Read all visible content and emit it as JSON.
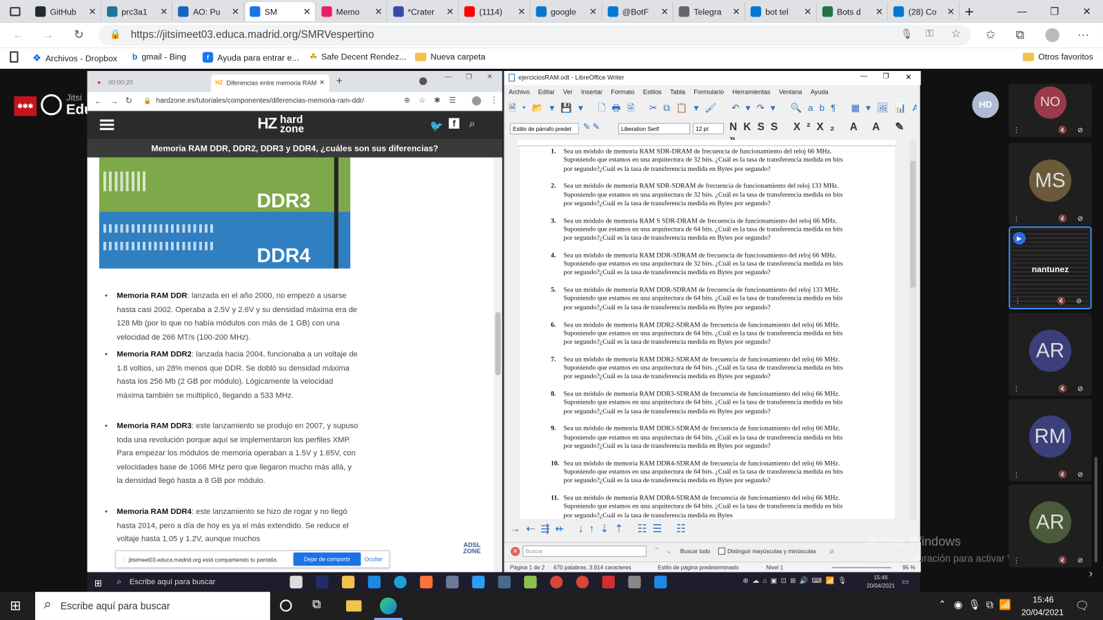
{
  "edge": {
    "tabs": [
      {
        "label": "GitHub",
        "icon": "github-icon",
        "color": "#24292e"
      },
      {
        "label": "prc3a1",
        "icon": "wordpress-icon",
        "color": "#21759b"
      },
      {
        "label": "AO: Pu",
        "icon": "education-icon",
        "color": "#1565c0"
      },
      {
        "label": "SM",
        "icon": "meeting-icon",
        "color": "#1a73e8"
      },
      {
        "label": "Memo",
        "icon": "site-icon",
        "color": "#e91e63"
      },
      {
        "label": "*Crater",
        "icon": "globe-icon",
        "color": "#3949ab"
      },
      {
        "label": "(1114)",
        "icon": "youtube-icon",
        "color": "#ff0000"
      },
      {
        "label": "google",
        "icon": "bing-icon",
        "color": "#0078d4"
      },
      {
        "label": "@BotF",
        "icon": "bing-icon",
        "color": "#0078d4"
      },
      {
        "label": "Telegra",
        "icon": "page-icon",
        "color": "#666666"
      },
      {
        "label": "bot tel",
        "icon": "bing-icon",
        "color": "#0078d4"
      },
      {
        "label": "Bots d",
        "icon": "excel-icon",
        "color": "#217346"
      },
      {
        "label": "(28) Co",
        "icon": "mail-icon",
        "color": "#0078d4"
      }
    ],
    "url": "https://jitsimeet03.educa.madrid.org/SMRVespertino",
    "favorites": [
      "Archivos - Dropbox",
      "gmail - Bing",
      "Ayuda para entrar e...",
      "Safe Decent Rendez...",
      "Nueva carpeta"
    ],
    "other_favorites": "Otros favoritos"
  },
  "jitsi": {
    "brand_small": "Jitsi",
    "brand": "EducaMadrid"
  },
  "left_browser": {
    "tabs": [
      "00:00:20",
      "Diferencias entre memoria RAM"
    ],
    "url": "hardzone.es/tutoriales/componentes/diferencias-memoria-ram-ddr/",
    "logo": "hard zone",
    "headline": "Memoria RAM DDR, DDR2, DDR3 y DDR4, ¿cuáles son sus diferencias?",
    "image_labels": [
      "DDR3",
      "DDR4"
    ],
    "bullets": [
      {
        "title": "Memoria RAM DDR",
        "text": ": lanzada en el año 2000, no empezó a usarse hasta casi 2002. Operaba a 2.5V y 2.6V y su densidad máxima era de 128 Mb (por lo que no había módulos con más de 1 GB) con una velocidad de 266 MT/s (100-200 MHz)."
      },
      {
        "title": "Memoria RAM DDR2",
        "text": ": lanzada hacia 2004, funcionaba a un voltaje de 1.8 voltios, un 28% menos que DDR. Se dobló su densidad máxima hasta los 256 Mb (2 GB por módulo). Lógicamente la velocidad máxima también se multiplicó, llegando a 533 MHz."
      },
      {
        "title": "Memoria RAM DDR3",
        "text": ": este lanzamiento se produjo en 2007, y supuso toda una revolución porque aquí se implementaron los perfiles XMP. Para empezar los módulos de memoria operaban a 1.5V y 1.65V, con velocidades base de 1066 MHz pero que llegaron mucho más allá, y la densidad llegó hasta a 8 GB por módulo."
      },
      {
        "title": "Memoria RAM DDR4",
        "text": ": este lanzamiento se hizo de rogar y no llegó hasta 2014, pero a día de hoy es ya el más extendido. Se reduce el voltaje hasta 1.05 y 1.2V, aunque muchos"
      }
    ],
    "share_text": "jitsimeet03.educa.madrid.org está compartiendo tu pantalla.",
    "share_stop": "Dejar de compartir",
    "share_hide": "Ocultar",
    "adsl_zone": "ADSL ZONE"
  },
  "writer": {
    "title": "ejerciciosRAM.odt - LibreOffice Writer",
    "menu": [
      "Archivo",
      "Editar",
      "Ver",
      "Insertar",
      "Formato",
      "Estilos",
      "Tabla",
      "Formulario",
      "Herramientas",
      "Ventana",
      "Ayuda"
    ],
    "para_style": "Estilo de párrafo predet",
    "font": "Liberation Serif",
    "size": "12 pt",
    "questions": [
      "Sea un módulo de memoria RAM SDR-DRAM de frecuencia de funcionamiento del reloj 66 MHz. Suponiendo que estamos en una arquitectura de 32 bits. ¿Cuál es la tasa de transferencia medida en bits por segundo?¿Cuál es la tasa de transferencia medida en Bytes por segundo?",
      "Sea un módulo de memoria RAM SDR-SDRAM de frecuencia de funcionamiento del reloj 133 MHz. Suponiendo que estamos en una arquitectura de 32 bits. ¿Cuál es la tasa de transferencia medida en bits por segundo?¿Cuál es la tasa de transferencia medida en Bytes por segundo?",
      "Sea un módulo de memoria RAM S SDR-DRAM de frecuencia de funcionamiento del reloj 66 MHz. Suponiendo que estamos en una arquitectura de 64 bits. ¿Cuál es la tasa de transferencia medida en bits por segundo?¿Cuál es la tasa de transferencia medida en Bytes por segundo?",
      "Sea un módulo de memoria RAM DDR-SDRAM de frecuencia de funcionamiento del reloj 66 MHz. Suponiendo que estamos en una arquitectura de 32 bits. ¿Cuál es la tasa de transferencia medida en bits por segundo?¿Cuál es la tasa de transferencia medida en Bytes por segundo?",
      "Sea un módulo de memoria RAM DDR-SDRAM de frecuencia de funcionamiento del reloj 133 MHz. Suponiendo que estamos en una arquitectura de 64 bits. ¿Cuál es la tasa de transferencia medida en bits por segundo?¿Cuál es la tasa de transferencia medida en Bytes por segundo?",
      "Sea un módulo de memoria RAM DDR2-SDRAM de frecuencia de funcionamiento del reloj 66 MHz. Suponiendo que estamos en una arquitectura de 64 bits. ¿Cuál es la tasa de transferencia medida en bits por segundo?¿Cuál es la tasa de transferencia medida en Bytes por segundo?",
      "Sea un módulo de memoria RAM DDR2-SDRAM de frecuencia de funcionamiento del reloj 66 MHz. Suponiendo que estamos en una arquitectura de 64 bits. ¿Cuál es la tasa de transferencia medida en bits por segundo?¿Cuál es la tasa de transferencia medida en Bytes por segundo?",
      "Sea un módulo de memoria RAM DDR3-SDRAM de frecuencia de funcionamiento del reloj 66 MHz. Suponiendo que estamos en una arquitectura de 64 bits. ¿Cuál es la tasa de transferencia medida en bits por segundo?¿Cuál es la tasa de transferencia medida en Bytes por segundo?",
      "Sea un módulo de memoria RAM DDR3-SDRAM de frecuencia de funcionamiento del reloj 66 MHz. Suponiendo que estamos en una arquitectura de 64 bits. ¿Cuál es la tasa de transferencia medida en bits por segundo?¿Cuál es la tasa de transferencia medida en Bytes por segundo?",
      "Sea un módulo de memoria RAM DDR4-SDRAM de frecuencia de funcionamiento del reloj 66 MHz. Suponiendo que estamos en una arquitectura de 64 bits. ¿Cuál es la tasa de transferencia medida en bits por segundo?¿Cuál es la tasa de transferencia medida en Bytes por segundo?",
      "Sea un módulo de memoria RAM DDR4-SDRAM de frecuencia de funcionamiento del reloj 66 MHz. Suponiendo que estamos en una arquitectura de 64 bits. ¿Cuál es la tasa de transferencia medida en bits por segundo?¿Cuál es la tasa de transferencia medida en Bytes"
    ],
    "find_placeholder": "Buscar",
    "find_all": "Buscar todo",
    "match_case": "Distinguir mayúsculas y minúsculas",
    "status": {
      "page": "Página 1 de 2",
      "words": "670 palabras, 3.914 caracteres",
      "page_style": "Estilo de página predeterminado",
      "level": "Nivel 1",
      "zoom": "95 %"
    }
  },
  "watermark": {
    "line1": "Activar Windows",
    "line2": "Ve a Configuración para activar Windows."
  },
  "participants": [
    {
      "initials": "NO",
      "color": "#9b3a4a",
      "name": ""
    },
    {
      "initials": "MS",
      "color": "#6b5a3a",
      "name": ""
    },
    {
      "initials": "",
      "color": "#2a2a2a",
      "name": "nantunez"
    },
    {
      "initials": "AR",
      "color": "#3b3f7a",
      "name": ""
    },
    {
      "initials": "RM",
      "color": "#3b3f7a",
      "name": ""
    },
    {
      "initials": "AR",
      "color": "#4a5a3a",
      "name": ""
    }
  ],
  "self_view": "HD",
  "inner_taskbar": {
    "search": "Escribe aquí para buscar",
    "time": "15:46",
    "date": "20/04/2021"
  },
  "outer_taskbar": {
    "search": "Escribe aquí para buscar",
    "time": "15:46",
    "date": "20/04/2021"
  }
}
